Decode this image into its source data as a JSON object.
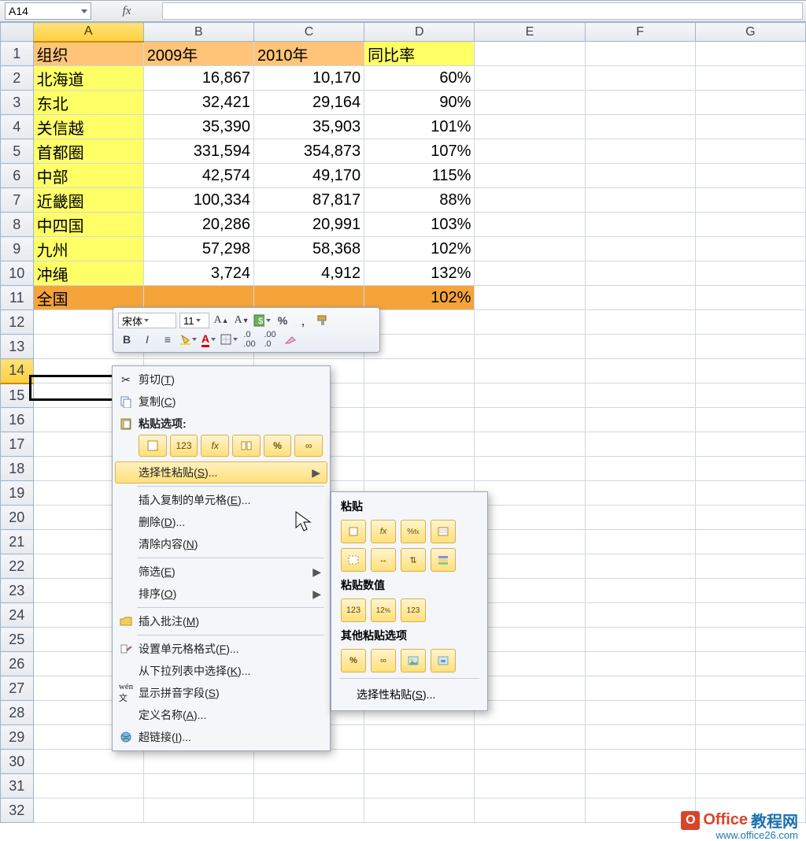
{
  "name_box": "A14",
  "formula": "",
  "columns": [
    "A",
    "B",
    "C",
    "D",
    "E",
    "F",
    "G"
  ],
  "headers": {
    "org": "组织",
    "y2009": "2009年",
    "y2010": "2010年",
    "ratio": "同比率"
  },
  "rows": [
    {
      "label": "北海道",
      "y2009": "16,867",
      "y2010": "10,170",
      "ratio": "60%"
    },
    {
      "label": "东北",
      "y2009": "32,421",
      "y2010": "29,164",
      "ratio": "90%"
    },
    {
      "label": "关信越",
      "y2009": "35,390",
      "y2010": "35,903",
      "ratio": "101%"
    },
    {
      "label": "首都圈",
      "y2009": "331,594",
      "y2010": "354,873",
      "ratio": "107%"
    },
    {
      "label": "中部",
      "y2009": "42,574",
      "y2010": "49,170",
      "ratio": "115%"
    },
    {
      "label": "近畿圈",
      "y2009": "100,334",
      "y2010": "87,817",
      "ratio": "88%"
    },
    {
      "label": "中四国",
      "y2009": "20,286",
      "y2010": "20,991",
      "ratio": "103%"
    },
    {
      "label": "九州",
      "y2009": "57,298",
      "y2010": "58,368",
      "ratio": "102%"
    },
    {
      "label": "冲绳",
      "y2009": "3,724",
      "y2010": "4,912",
      "ratio": "132%"
    }
  ],
  "total_row": {
    "label": "全国",
    "ratio": "102%"
  },
  "mini_toolbar": {
    "font": "宋体",
    "size": "11"
  },
  "context_menu": {
    "cut": "剪切(T)",
    "copy": "复制(C)",
    "paste_options": "粘贴选项:",
    "paste_special": "选择性粘贴(S)...",
    "insert_copied": "插入复制的单元格(E)...",
    "delete": "删除(D)...",
    "clear": "清除内容(N)",
    "filter": "筛选(E)",
    "sort": "排序(O)",
    "insert_comment": "插入批注(M)",
    "format_cells": "设置单元格格式(F)...",
    "dropdown": "从下拉列表中选择(K)...",
    "pinyin": "显示拼音字段(S)",
    "define_name": "定义名称(A)...",
    "hyperlink": "超链接(I)..."
  },
  "submenu": {
    "paste": "粘贴",
    "paste_values": "粘贴数值",
    "other": "其他粘贴选项",
    "paste_special_txt": "选择性粘贴(S)..."
  },
  "paste_icon_labels": {
    "v123": "123",
    "fx": "fx",
    "pct": "%"
  },
  "watermark": {
    "brand1": "Office",
    "brand2": "教程网",
    "url": "www.office26.com",
    "logo": "O"
  },
  "chart_data": {
    "type": "table",
    "title": "",
    "columns": [
      "组织",
      "2009年",
      "2010年",
      "同比率"
    ],
    "rows": [
      [
        "北海道",
        16867,
        10170,
        "60%"
      ],
      [
        "东北",
        32421,
        29164,
        "90%"
      ],
      [
        "关信越",
        35390,
        35903,
        "101%"
      ],
      [
        "首都圈",
        331594,
        354873,
        "107%"
      ],
      [
        "中部",
        42574,
        49170,
        "115%"
      ],
      [
        "近畿圈",
        100334,
        87817,
        "88%"
      ],
      [
        "中四国",
        20286,
        20991,
        "103%"
      ],
      [
        "九州",
        57298,
        58368,
        "102%"
      ],
      [
        "冲绳",
        3724,
        4912,
        "132%"
      ],
      [
        "全国",
        null,
        null,
        "102%"
      ]
    ]
  }
}
